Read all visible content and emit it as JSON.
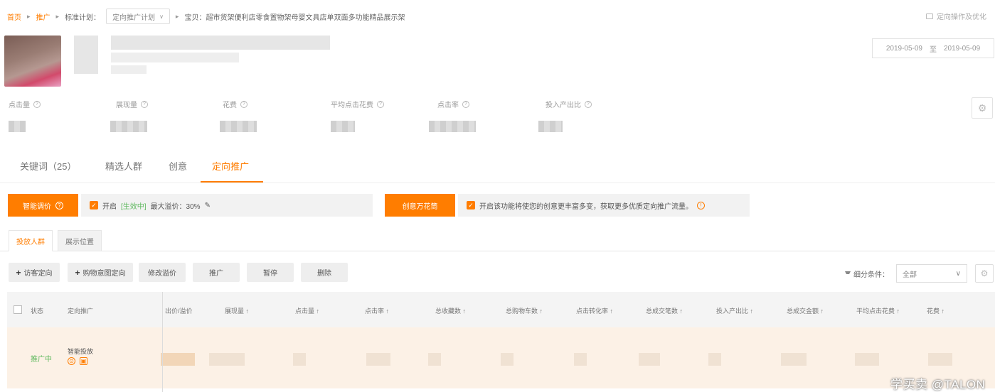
{
  "breadcrumb": {
    "home": "首页",
    "promo": "推广",
    "plan_label": "标准计划：",
    "plan_select": "定向推广计划",
    "unit_label": "宝贝：超市货架便利店零食置物架母婴文具店单双面多功能精品展示架"
  },
  "top_right": {
    "label": "定向操作及优化"
  },
  "date_range": {
    "start": "2019-05-09",
    "to": "至",
    "end": "2019-05-09"
  },
  "metrics": [
    {
      "label": "点击量"
    },
    {
      "label": "展现量"
    },
    {
      "label": "花费"
    },
    {
      "label": "平均点击花费"
    },
    {
      "label": "点击率"
    },
    {
      "label": "投入产出比"
    }
  ],
  "main_tabs": [
    {
      "label": "关键词（25）"
    },
    {
      "label": "精选人群"
    },
    {
      "label": "创意"
    },
    {
      "label": "定向推广"
    }
  ],
  "smart_bid": {
    "button": "智能调价",
    "on_label": "开启",
    "status": "[生效中]",
    "max_bid": "最大溢价：30%"
  },
  "creative": {
    "button": "创意万花筒",
    "text": "开启该功能将使您的创意更丰富多变，获取更多优质定向推广流量。"
  },
  "sub_tabs": [
    {
      "label": "投放人群"
    },
    {
      "label": "展示位置"
    }
  ],
  "actions": {
    "add_visitor": "访客定向",
    "add_intent": "购物意图定向",
    "modify_bid": "修改溢价",
    "promote": "推广",
    "pause": "暂停",
    "delete": "删除"
  },
  "filter": {
    "label": "细分条件：",
    "value": "全部"
  },
  "table": {
    "headers": [
      "状态",
      "定向推广",
      "出价/溢价",
      "展现量 ↑",
      "点击量 ↑",
      "点击率 ↑",
      "总收藏数 ↑",
      "总购物车数 ↑",
      "点击转化率 ↑",
      "总成交笔数 ↑",
      "投入产出比 ↑",
      "总成交金额 ↑",
      "平均点击花费 ↑",
      "花费 ↑"
    ],
    "rows": [
      {
        "status": "推广中",
        "name": "智能投放"
      }
    ]
  },
  "watermark": "学买卖 @TALON"
}
